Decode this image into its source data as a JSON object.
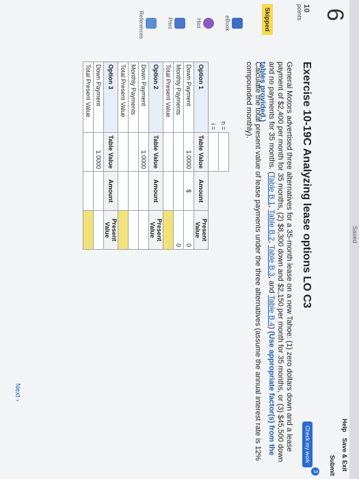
{
  "header": {
    "saved": "Saved",
    "help": "Help",
    "save_exit": "Save & Exit",
    "submit": "Submit",
    "check": "Check my work",
    "check_badge": "3"
  },
  "question": {
    "number": "6",
    "points_value": "10",
    "points_label": "points",
    "status": "Skipped",
    "title": "Exercise 10-19C Analyzing lease options LO C3",
    "text_1": "General Motors advertised three alternatives for a 35-month lease on a new Tahoe: (1) zero dollars down and a lease payment of $2,400 per month for 35 months, (2) $8,300 down and $2,150 per month for 35 months, or (3) $45,500 down and no payments for 35 months.",
    "links": [
      "Table B.1",
      "Table B.2",
      "Table B.3",
      "Table B.4"
    ],
    "and_text": "and",
    "sep": ",",
    "emph": "(Use appropriate factor(s) from the tables provided.)",
    "calc": "Calculate the total present value of lease payments under the three alternatives (assume the annual interest rate is 12% compounded monthly)."
  },
  "sidebar": {
    "ebook": "eBook",
    "hint": "Hint",
    "print": "Print",
    "references": "References"
  },
  "table": {
    "n_label": "n =",
    "i_label": "i =",
    "col_table": "Table Value",
    "col_amount": "Amount",
    "col_pv": "Present Value",
    "opt1": "Option 1",
    "opt2": "Option 2",
    "opt3": "Option 3",
    "down": "Down Payment",
    "monthly": "Monthly Payments",
    "total": "Total Present Value",
    "one": "1.0000",
    "dollar": "$",
    "zero": "0"
  },
  "footer": {
    "next": "Next"
  }
}
